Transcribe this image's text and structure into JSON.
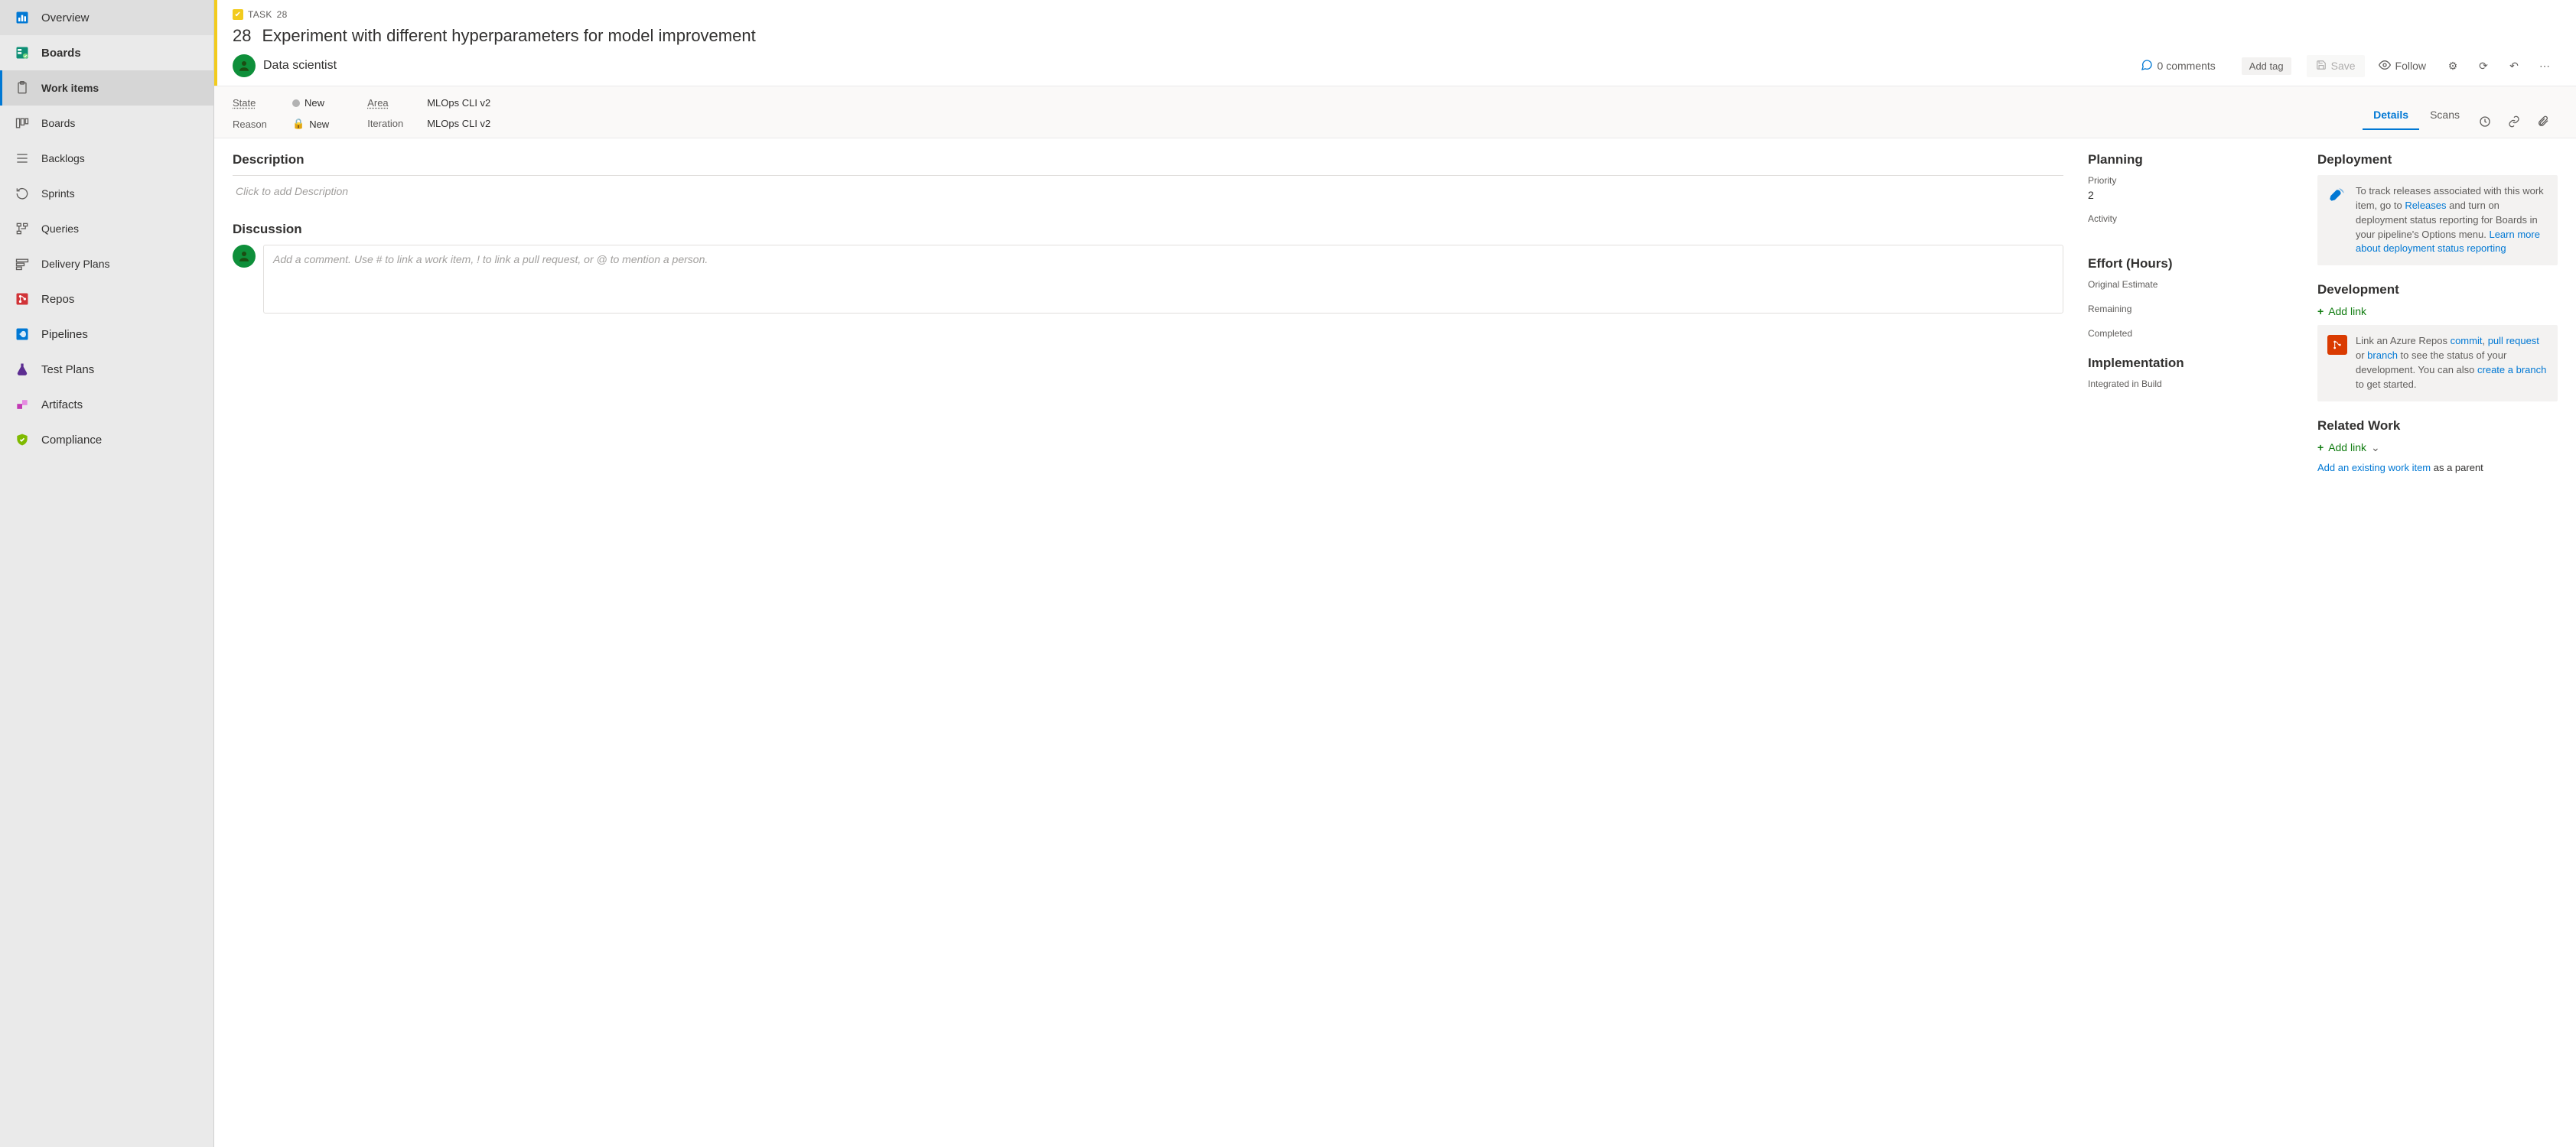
{
  "sidebar": {
    "overview": "Overview",
    "boards": "Boards",
    "children": {
      "work_items": "Work items",
      "boards": "Boards",
      "backlogs": "Backlogs",
      "sprints": "Sprints",
      "queries": "Queries",
      "delivery_plans": "Delivery Plans"
    },
    "repos": "Repos",
    "pipelines": "Pipelines",
    "test_plans": "Test Plans",
    "artifacts": "Artifacts",
    "compliance": "Compliance"
  },
  "task": {
    "type_label": "TASK",
    "id": "28",
    "breadcrumb_id": "28",
    "title": "Experiment with different hyperparameters for model improvement",
    "assignee": "Data scientist",
    "comments_count": "0 comments",
    "add_tag": "Add tag",
    "save": "Save",
    "follow": "Follow"
  },
  "fields": {
    "state_label": "State",
    "state_value": "New",
    "reason_label": "Reason",
    "reason_value": "New",
    "area_label": "Area",
    "area_value": "MLOps CLI v2",
    "iteration_label": "Iteration",
    "iteration_value": "MLOps CLI v2"
  },
  "tabs": {
    "details": "Details",
    "scans": "Scans"
  },
  "main_col": {
    "description_title": "Description",
    "description_placeholder": "Click to add Description",
    "discussion_title": "Discussion",
    "discussion_placeholder": "Add a comment. Use # to link a work item, ! to link a pull request, or @ to mention a person."
  },
  "planning": {
    "title": "Planning",
    "priority_label": "Priority",
    "priority_value": "2",
    "activity_label": "Activity",
    "effort_title": "Effort (Hours)",
    "original_estimate": "Original Estimate",
    "remaining": "Remaining",
    "completed": "Completed",
    "implementation_title": "Implementation",
    "integrated_in_build": "Integrated in Build"
  },
  "right": {
    "deployment_title": "Deployment",
    "deployment_text_1": "To track releases associated with this work item, go to ",
    "deployment_link_releases": "Releases",
    "deployment_text_2": " and turn on deployment status reporting for Boards in your pipeline's Options menu. ",
    "deployment_link_learn": "Learn more about deployment status reporting",
    "development_title": "Development",
    "add_link": "Add link",
    "dev_text_1": "Link an Azure Repos ",
    "dev_link_commit": "commit",
    "dev_sep_1": ", ",
    "dev_link_pr": "pull request",
    "dev_sep_2": " or ",
    "dev_link_branch": "branch",
    "dev_text_2": " to see the status of your development. You can also ",
    "dev_link_create": "create a branch",
    "dev_text_3": " to get started.",
    "related_title": "Related Work",
    "related_text_1": "Add an existing work item",
    "related_text_2": " as a parent"
  }
}
